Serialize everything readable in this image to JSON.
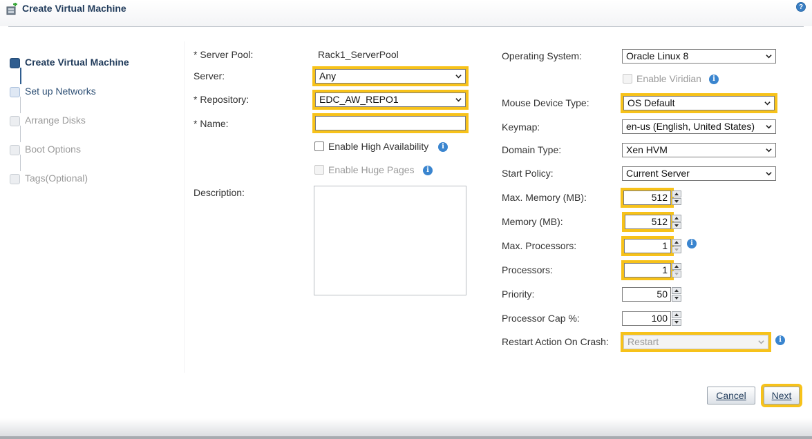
{
  "window": {
    "title": "Create Virtual Machine",
    "title_icon": "add-vm-icon",
    "help_icon": "help-icon"
  },
  "steps": [
    {
      "label": "Create Virtual Machine",
      "state": "active"
    },
    {
      "label": "Set up Networks",
      "state": "link"
    },
    {
      "label": "Arrange Disks",
      "state": "disabled"
    },
    {
      "label": "Boot Options",
      "state": "disabled"
    },
    {
      "label": "Tags(Optional)",
      "state": "disabled"
    }
  ],
  "form_left": {
    "server_pool_label": "* Server Pool:",
    "server_pool_value": "Rack1_ServerPool",
    "server_label": "Server:",
    "server_value": "Any",
    "repository_label": "* Repository:",
    "repository_value": "EDC_AW_REPO1",
    "name_label": "* Name:",
    "name_value": "",
    "enable_ha_label": "Enable High Availability",
    "enable_hugepages_label": "Enable Huge Pages",
    "description_label": "Description:",
    "description_value": ""
  },
  "form_right": {
    "os_label": "Operating System:",
    "os_value": "Oracle Linux 8",
    "viridian_label": "Enable Viridian",
    "mouse_label": "Mouse Device Type:",
    "mouse_value": "OS Default",
    "keymap_label": "Keymap:",
    "keymap_value": "en-us (English, United States)",
    "domain_label": "Domain Type:",
    "domain_value": "Xen HVM",
    "start_policy_label": "Start Policy:",
    "start_policy_value": "Current Server",
    "max_memory_label": "Max. Memory (MB):",
    "max_memory_value": "512",
    "memory_label": "Memory (MB):",
    "memory_value": "512",
    "max_proc_label": "Max. Processors:",
    "max_proc_value": "1",
    "proc_label": "Processors:",
    "proc_value": "1",
    "priority_label": "Priority:",
    "priority_value": "50",
    "cap_label": "Processor Cap %:",
    "cap_value": "100",
    "restart_label": "Restart Action On Crash:",
    "restart_value": "Restart"
  },
  "buttons": {
    "cancel": "Cancel",
    "next": "Next"
  },
  "colors": {
    "highlight": "#f7c21a",
    "accent": "#2f5d8f",
    "info": "#3a85cf"
  }
}
